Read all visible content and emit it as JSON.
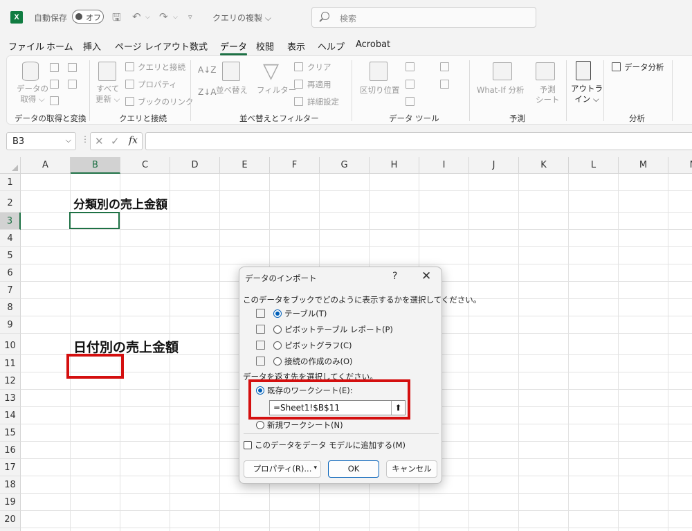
{
  "titlebar": {
    "autosave_label": "自動保存",
    "toggle_label": "オフ",
    "doc_title": "クエリの複製 ⌵",
    "search_placeholder": "検索"
  },
  "menu": {
    "tabs": [
      "ファイル",
      "ホーム",
      "挿入",
      "ページ レイアウト",
      "数式",
      "データ",
      "校閲",
      "表示",
      "ヘルプ",
      "Acrobat"
    ],
    "active": "データ"
  },
  "ribbon": {
    "get_data": "データの\n取得 ⌵",
    "refresh_all": "すべて\n更新 ⌵",
    "queries_connections": "クエリと接続",
    "properties": "プロパティ",
    "edit_links": "ブックのリンク",
    "sort": "並べ替え",
    "filter": "フィルター",
    "clear": "クリア",
    "reapply": "再適用",
    "advanced": "詳細設定",
    "text_to_columns": "区切り位置",
    "what_if": "What-If 分析",
    "forecast_sheet": "予測\nシート",
    "outline": "アウトラ\nイン ⌵",
    "data_analysis": "データ分析",
    "groups": {
      "get_transform": "データの取得と変換",
      "queries": "クエリと接続",
      "sort_filter": "並べ替えとフィルター",
      "data_tools": "データ ツール",
      "forecast": "予測",
      "analysis": "分析"
    }
  },
  "formula_bar": {
    "name_box": "B3",
    "formula": ""
  },
  "sheet": {
    "columns": [
      "A",
      "B",
      "C",
      "D",
      "E",
      "F",
      "G",
      "H",
      "I",
      "J",
      "K",
      "L",
      "M",
      "N"
    ],
    "rows": [
      "1",
      "2",
      "3",
      "4",
      "5",
      "6",
      "7",
      "8",
      "9",
      "10",
      "11",
      "12",
      "13",
      "14",
      "15",
      "16",
      "17",
      "18",
      "19",
      "20"
    ],
    "b2": "分類別の売上金額",
    "b10": "日付別の売上金額"
  },
  "dialog": {
    "title": "データのインポート",
    "help": "?",
    "close": "✕",
    "prompt1": "このデータをブックでどのように表示するかを選択してください。",
    "opt_table": "テーブル(T)",
    "opt_pivot_table": "ピボットテーブル レポート(P)",
    "opt_pivot_chart": "ピボットグラフ(C)",
    "opt_connection_only": "接続の作成のみ(O)",
    "prompt2": "データを返す先を選択してください。",
    "existing_sheet": "既存のワークシート(E):",
    "range_value": "=Sheet1!$B$11",
    "new_sheet": "新規ワークシート(N)",
    "add_to_model": "このデータをデータ モデルに追加する(M)",
    "properties_btn": "プロパティ(R)...",
    "ok_btn": "OK",
    "cancel_btn": "キャンセル"
  },
  "colors": {
    "excel_green": "#1e7145",
    "highlight_red": "#d40f0f",
    "accent_blue": "#005fb8"
  }
}
